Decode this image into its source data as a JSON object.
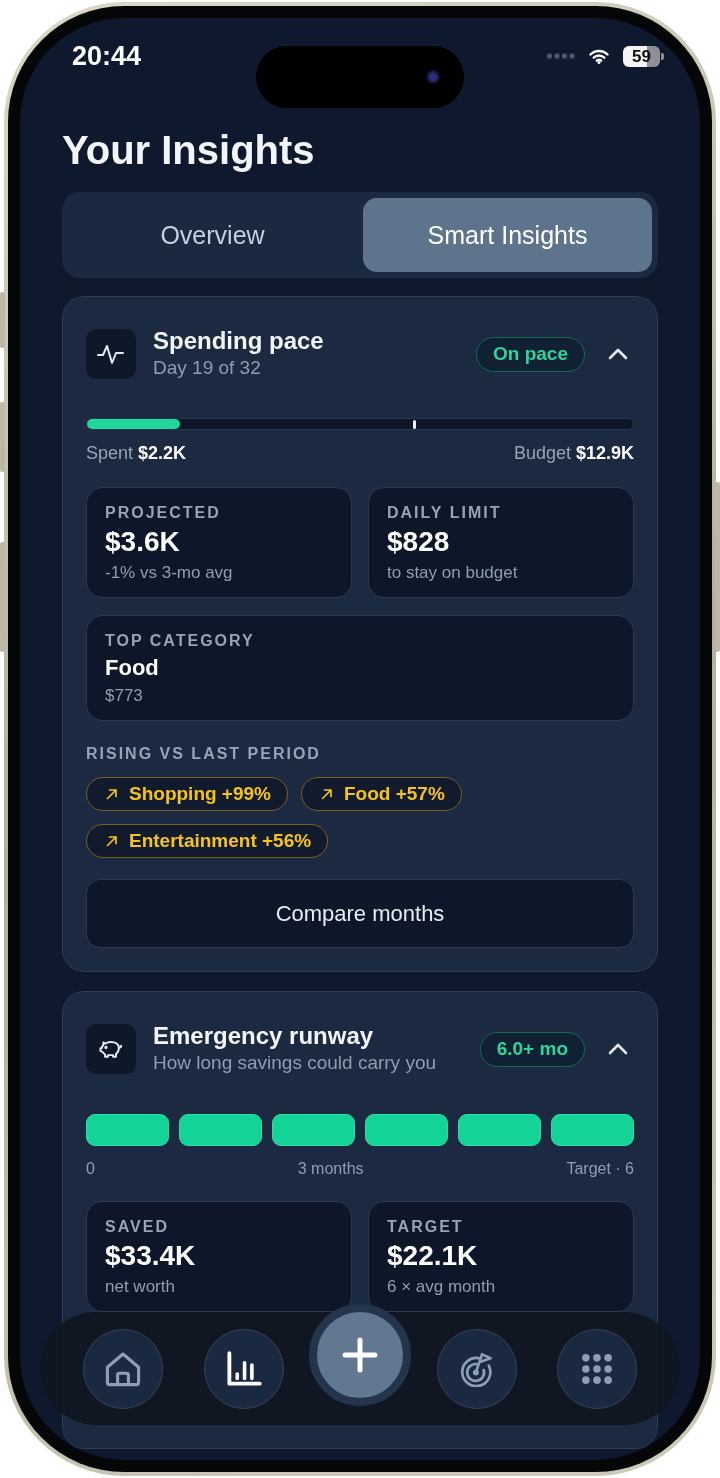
{
  "status_bar": {
    "time": "20:44",
    "battery": "59"
  },
  "title": "Your Insights",
  "tabs": [
    {
      "label": "Overview",
      "selected": false
    },
    {
      "label": "Smart Insights",
      "selected": true
    }
  ],
  "cards": [
    {
      "kind": "pace",
      "title": "Spending pace",
      "subtitle": "Day 19 of 32",
      "badge": "On pace",
      "expanded": true,
      "progress": {
        "level": 0.17
      },
      "pace_marker": {
        "level": 0.6
      },
      "spent": "Spent **$2.2K**",
      "budget": "Budget **$12.9K**",
      "stat_rows": [
        [
          {
            "kind": "amount",
            "label": "PROJECTED",
            "value": "$3.6K",
            "note": "-1% vs 3-mo avg"
          },
          {
            "kind": "amount",
            "label": "DAILY LIMIT",
            "value": "$828",
            "note": "to stay on budget"
          }
        ],
        [
          {
            "kind": "category",
            "label": "TOP CATEGORY",
            "value": "Food",
            "note": "$773"
          }
        ]
      ],
      "rising": {
        "label": "RISING VS LAST PERIOD",
        "chips": [
          "Shopping +99%",
          "Food +57%",
          "Entertainment +56%"
        ]
      },
      "button": "Compare months"
    },
    {
      "kind": "runway",
      "title": "Emergency runway",
      "subtitle": "How long savings could carry you",
      "badge": "6.0+ mo",
      "expanded": true,
      "segments": [
        {
          "filled": true
        },
        {
          "filled": true
        },
        {
          "filled": true
        },
        {
          "filled": true
        },
        {
          "filled": true
        },
        {
          "filled": true
        }
      ],
      "scale": [
        "0",
        "3 months",
        "Target · 6"
      ],
      "stat_rows": [
        [
          {
            "kind": "amount",
            "label": "SAVED",
            "value": "$33.4K",
            "note": "net worth"
          },
          {
            "kind": "amount",
            "label": "TARGET",
            "value": "$22.1K",
            "note": "6 × avg month"
          }
        ]
      ]
    }
  ],
  "nav": {
    "tabs": [
      {
        "kind": "home",
        "selected": false
      },
      {
        "kind": "charts",
        "selected": true
      },
      {
        "kind": "target",
        "selected": false
      },
      {
        "kind": "grid",
        "selected": false
      }
    ]
  }
}
